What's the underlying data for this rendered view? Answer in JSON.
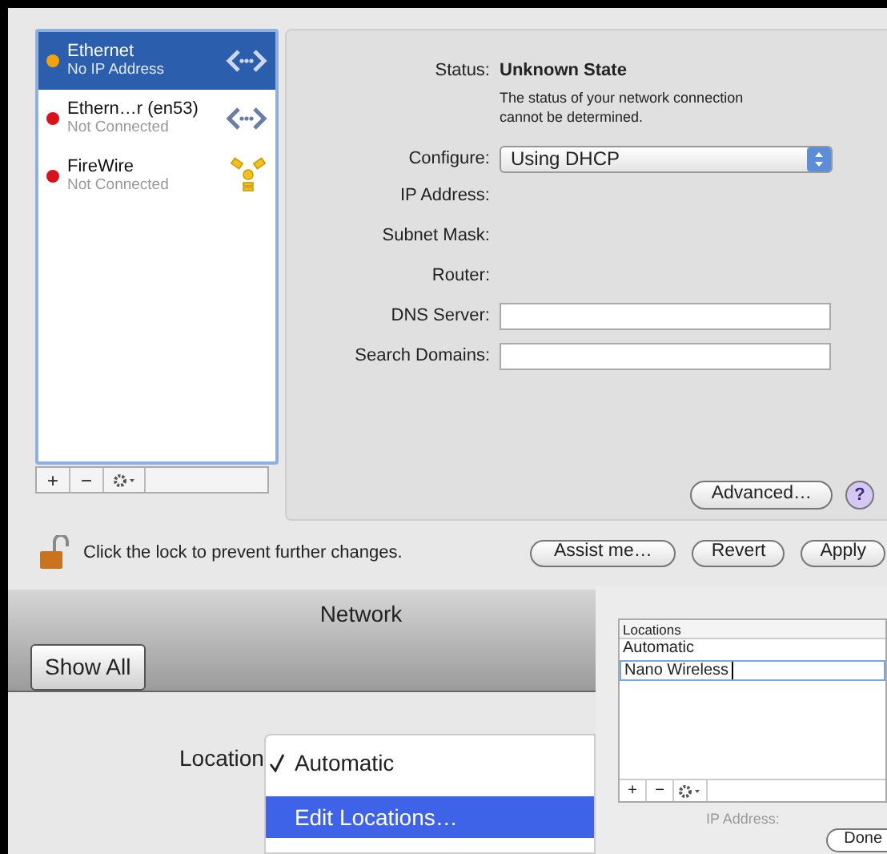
{
  "services": [
    {
      "name": "Ethernet",
      "status": "No IP Address",
      "color": "#f2a20c",
      "kind": "ethernet",
      "selected": true
    },
    {
      "name": "Ethern…r (en53)",
      "status": "Not Connected",
      "color": "#d8121b",
      "kind": "ethernet",
      "selected": false
    },
    {
      "name": "FireWire",
      "status": "Not Connected",
      "color": "#d8121b",
      "kind": "firewire",
      "selected": false
    }
  ],
  "list_toolbar": [
    "+",
    "−"
  ],
  "status": {
    "label": "Status:",
    "value": "Unknown State",
    "description": "The status of your network connection cannot be determined."
  },
  "configure": {
    "label": "Configure:",
    "value": "Using DHCP"
  },
  "fields": [
    {
      "label": "IP Address:",
      "kind": "text"
    },
    {
      "label": "Subnet Mask:",
      "kind": "text"
    },
    {
      "label": "Router:",
      "kind": "text"
    },
    {
      "label": "DNS Server:",
      "kind": "input"
    },
    {
      "label": "Search Domains:",
      "kind": "input"
    }
  ],
  "advanced_button": "Advanced…",
  "help_button": "?",
  "lock_text": "Click the lock to prevent further changes.",
  "bottom_buttons": [
    "Assist me…",
    "Revert",
    "Apply"
  ],
  "network_window": {
    "title": "Network",
    "show_all": "Show All",
    "location_label": "Location",
    "menu": [
      {
        "label": "Automatic",
        "checked": true,
        "selected": false
      },
      {
        "label": "Edit Locations…",
        "checked": false,
        "selected": true
      }
    ]
  },
  "locations_sheet": {
    "header": "Locations",
    "rows": [
      {
        "label": "Automatic",
        "editing": false
      },
      {
        "label": "Nano Wireless",
        "editing": true
      }
    ],
    "toolbar": [
      "+",
      "−"
    ],
    "background_labels": [
      "IP Address:"
    ],
    "done": "Done"
  }
}
